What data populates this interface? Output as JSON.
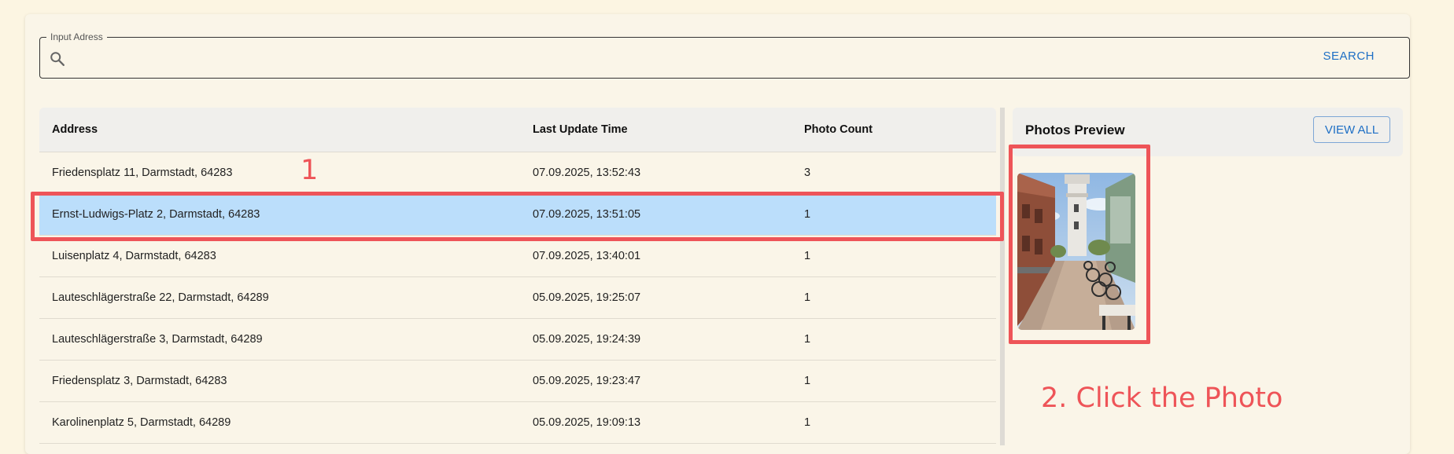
{
  "search": {
    "legend": "Input Adress",
    "placeholder": "",
    "button_label": "SEARCH",
    "icon": "search-icon"
  },
  "table": {
    "columns": {
      "address": "Address",
      "last_update": "Last Update Time",
      "photo_count": "Photo Count"
    },
    "selected_index": 1,
    "rows": [
      {
        "address": "Friedensplatz 11, Darmstadt, 64283",
        "time": "07.09.2025, 13:52:43",
        "count": "3"
      },
      {
        "address": "Ernst-Ludwigs-Platz 2, Darmstadt, 64283",
        "time": "07.09.2025, 13:51:05",
        "count": "1"
      },
      {
        "address": "Luisenplatz 4, Darmstadt, 64283",
        "time": "07.09.2025, 13:40:01",
        "count": "1"
      },
      {
        "address": "Lauteschlägerstraße 22, Darmstadt, 64289",
        "time": "05.09.2025, 19:25:07",
        "count": "1"
      },
      {
        "address": "Lauteschlägerstraße 3, Darmstadt, 64289",
        "time": "05.09.2025, 19:24:39",
        "count": "1"
      },
      {
        "address": "Friedensplatz 3, Darmstadt, 64283",
        "time": "05.09.2025, 19:23:47",
        "count": "1"
      },
      {
        "address": "Karolinenplatz 5, Darmstadt, 64289",
        "time": "05.09.2025, 19:09:13",
        "count": "1"
      }
    ]
  },
  "preview": {
    "title": "Photos Preview",
    "view_all_label": "VIEW ALL"
  },
  "annotations": {
    "step1": "1",
    "step2": "2. Click the Photo"
  },
  "colors": {
    "page_bg": "#fcf5e2",
    "accent": "#1e6fc5",
    "selected_row": "#bbdefb",
    "annotation": "#ee5458"
  }
}
